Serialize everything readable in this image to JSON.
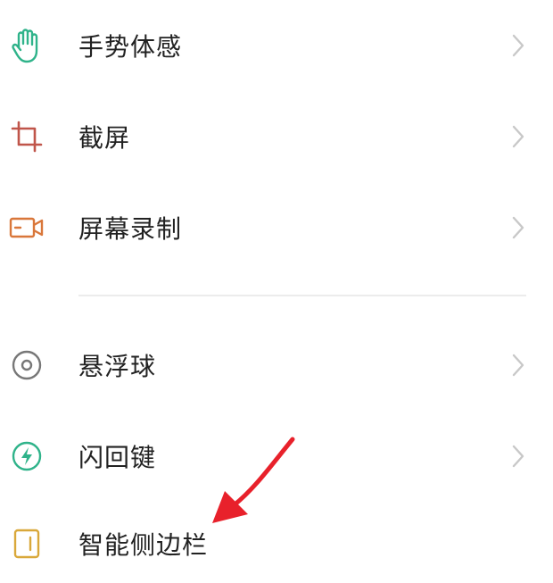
{
  "settings_list": {
    "items": [
      {
        "label": "手势体感",
        "icon": "hand-gesture-icon",
        "has_chevron": true
      },
      {
        "label": "截屏",
        "icon": "crop-icon",
        "has_chevron": true
      },
      {
        "label": "屏幕录制",
        "icon": "video-camera-icon",
        "has_chevron": true
      },
      {
        "label": "悬浮球",
        "icon": "floating-ball-icon",
        "has_chevron": true
      },
      {
        "label": "闪回键",
        "icon": "lightning-icon",
        "has_chevron": true
      },
      {
        "label": "智能侧边栏",
        "icon": "sidebar-icon",
        "has_chevron": false
      }
    ]
  },
  "colors": {
    "gesture_icon": "#2fb38a",
    "crop_icon": "#c0554a",
    "video_icon": "#d9773a",
    "floating_ball_icon": "#777777",
    "lightning_icon": "#2fb38a",
    "sidebar_icon": "#d9a83a",
    "annotation_arrow": "#e8212b",
    "chevron": "#c8c8c8",
    "text": "#222222"
  },
  "annotation": {
    "icon": "red-arrow-icon"
  }
}
